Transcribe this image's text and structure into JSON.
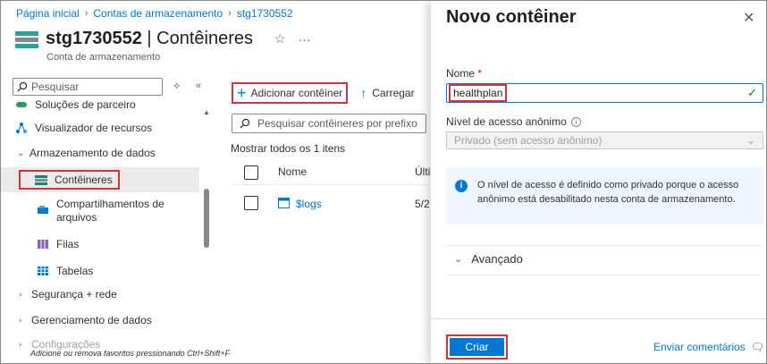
{
  "breadcrumb": [
    "Página inicial",
    "Contas de armazenamento",
    "stg1730552"
  ],
  "header": {
    "resource_name": "stg1730552",
    "separator_title": " | Contêineres",
    "subtitle": "Conta de armazenamento",
    "favorite_icon": "☆",
    "more_icon": "···"
  },
  "nav": {
    "search_placeholder": "Pesquisar",
    "items": [
      {
        "label": "Soluções de parceiro",
        "icon": "partner-icon"
      },
      {
        "label": "Visualizador de recursos",
        "icon": "resource-visualizer-icon"
      },
      {
        "label": "Armazenamento de dados",
        "icon": "chevron-down-icon"
      },
      {
        "label": "Contêineres",
        "icon": "containers-icon"
      },
      {
        "label": "Compartilhamentos de arquivos",
        "icon": "file-shares-icon"
      },
      {
        "label": "Filas",
        "icon": "queues-icon"
      },
      {
        "label": "Tabelas",
        "icon": "tables-icon"
      },
      {
        "label": "Segurança + rede",
        "icon": "chevron-right-icon"
      },
      {
        "label": "Gerenciamento de dados",
        "icon": "chevron-right-icon"
      },
      {
        "label": "Configurações",
        "icon": "chevron-right-icon"
      }
    ],
    "favorites_hint": "Adicione ou remova favoritos pressionando Ctrl+Shift+F"
  },
  "toolbar": {
    "add_container": "Adicionar contêiner",
    "upload": "Carregar"
  },
  "containers": {
    "search_placeholder": "Pesquisar contêineres por prefixo",
    "showing": "Mostrar todos os 1 itens",
    "columns": [
      "Nome",
      "Últi"
    ],
    "rows": [
      {
        "name": "$logs",
        "modified": "5/2"
      }
    ]
  },
  "panel": {
    "title": "Novo contêiner",
    "name_label": "Nome",
    "required_mark": "*",
    "name_value": "healthplan",
    "access_label": "Nível de acesso anônimo",
    "access_value": "Privado (sem acesso anônimo)",
    "info_text": "O nível de acesso é definido como privado porque o acesso anônimo está desabilitado nesta conta de armazenamento.",
    "advanced_label": "Avançado",
    "create_button": "Criar",
    "feedback_link": "Enviar comentários"
  },
  "colors": {
    "accent": "#0078d4",
    "highlight": "#d13438",
    "success": "#107c10"
  }
}
